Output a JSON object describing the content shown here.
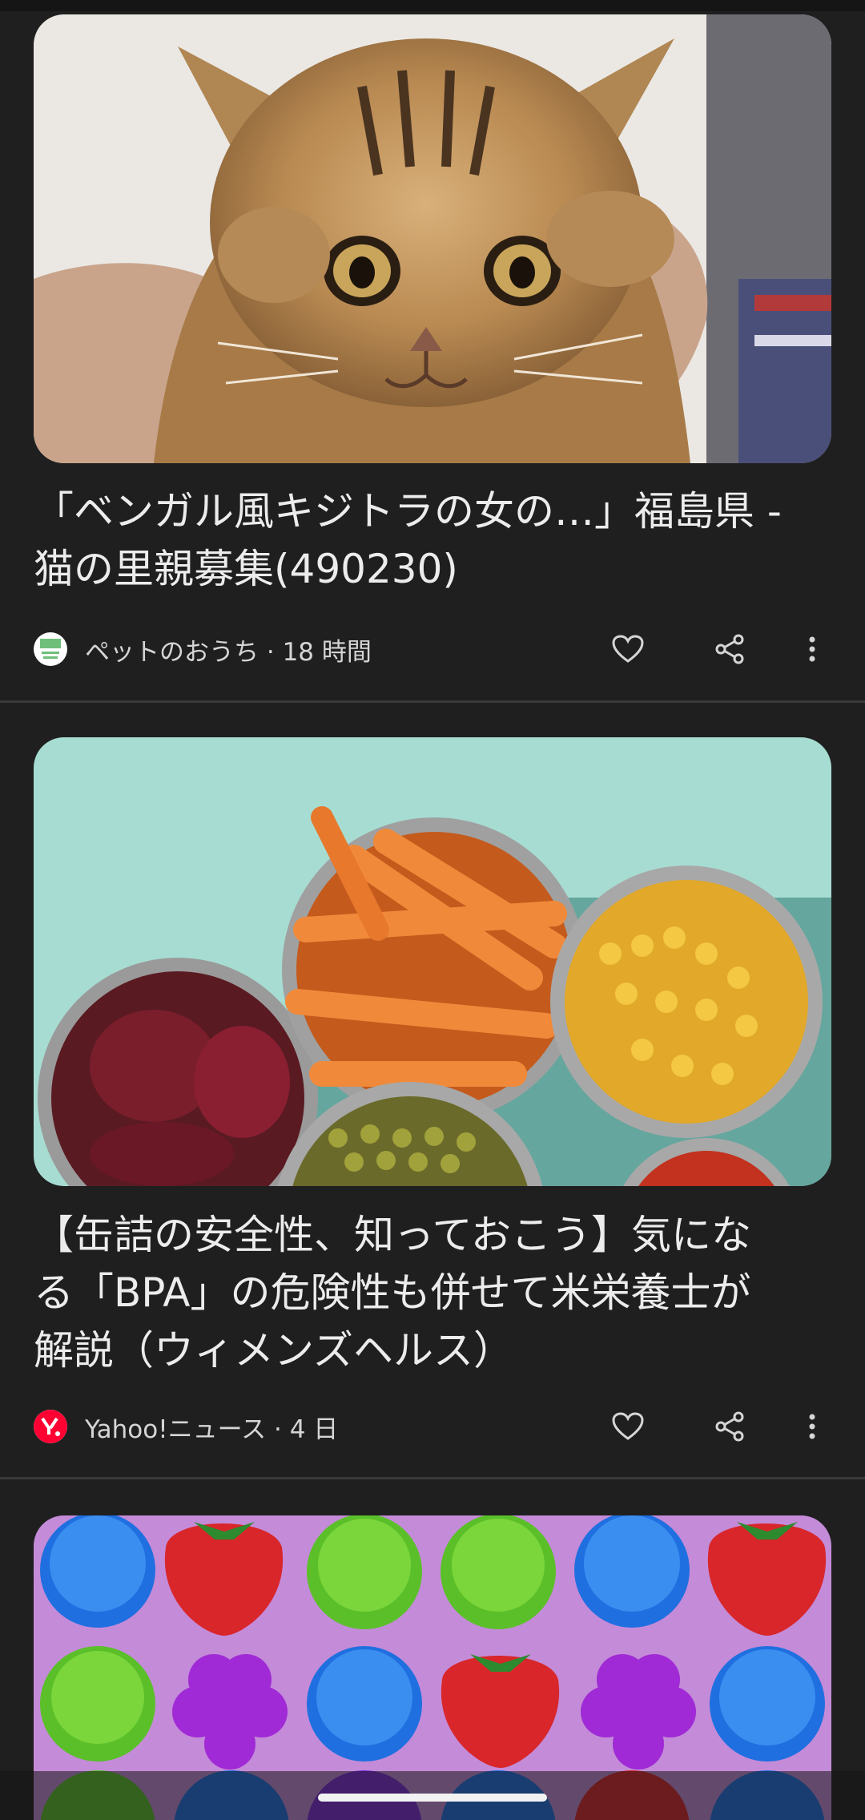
{
  "feed": {
    "cards": [
      {
        "title": "「ベンガル風キジトラの女の…」福島県 -\n猫の里親募集(490230)",
        "source": "ペットのおうち",
        "time": "18 時間",
        "separator": " · ",
        "image_icon": "kitten-photo",
        "logo_icon": "pet-house-logo-icon"
      },
      {
        "title": "【缶詰の安全性、知っておこう】気にな\nる「BPA」の危険性も併せて米栄養士が\n解説（ウィメンズヘルス）",
        "source": "Yahoo!ニュース",
        "time": "4 日",
        "separator": " · ",
        "image_icon": "canned-vegetables-photo",
        "logo_icon": "yahoo-logo-icon"
      },
      {
        "image_icon": "fruit-match-game-ad"
      }
    ]
  },
  "colors": {
    "background": "#1f1f1f",
    "divider": "#3a3a3a",
    "text": "#ececec",
    "meta_text": "#d5d5d5",
    "yahoo_red": "#ff0033"
  }
}
